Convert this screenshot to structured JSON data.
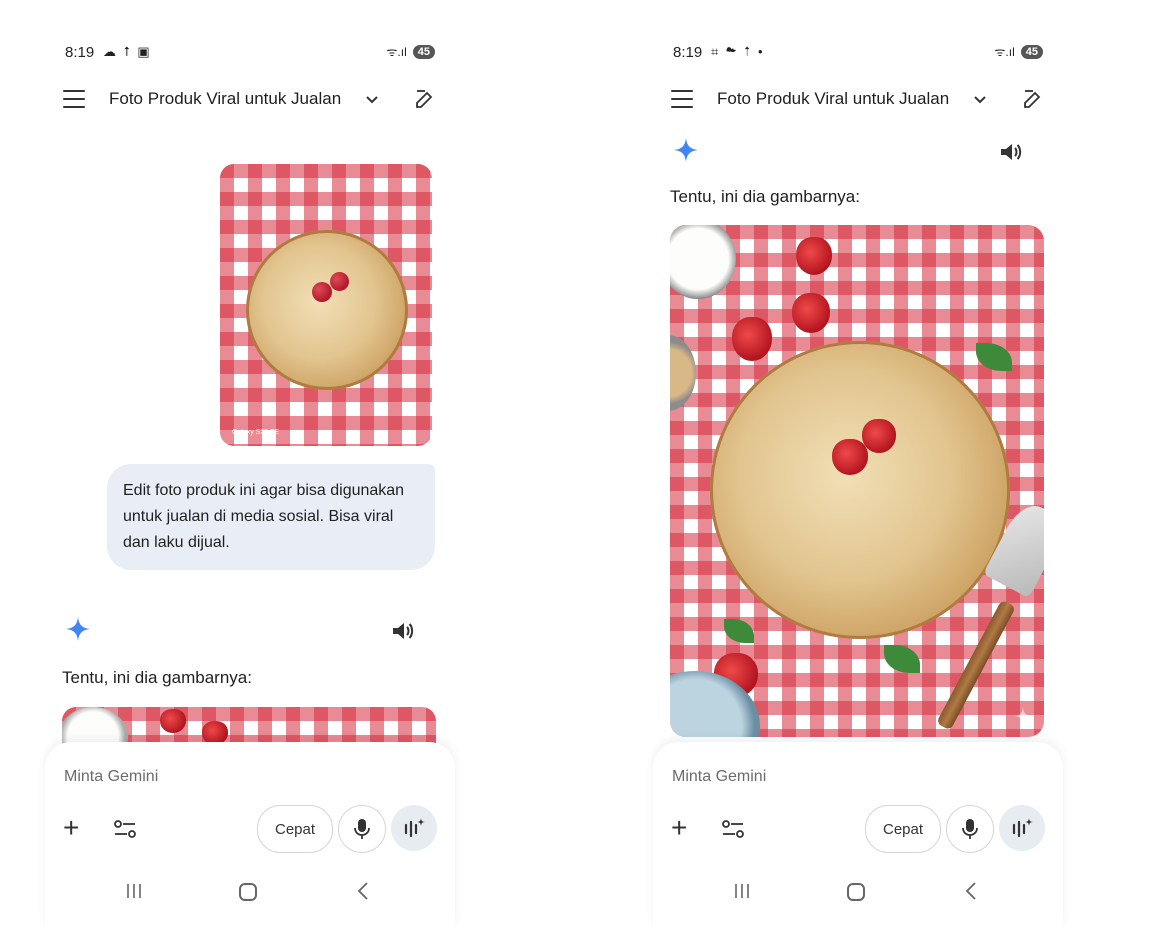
{
  "left": {
    "status": {
      "time": "8:19",
      "icons": "☁ ⭡ ▣",
      "battery": "45",
      "signal": "ᯤ.ıl"
    },
    "appbar": {
      "title": "Foto Produk Viral untuk Jualan",
      "chevron": "⌄"
    },
    "user_image": {
      "watermark": "Galaxy S25 FE"
    },
    "user_message": "Edit foto produk ini agar bisa digunakan untuk jualan di media sosial. Bisa viral dan laku dijual.",
    "response": {
      "text": "Tentu, ini dia gambarnya:"
    },
    "input": {
      "placeholder": "Minta Gemini",
      "mode_label": "Cepat",
      "plus": "+"
    }
  },
  "right": {
    "status": {
      "time": "8:19",
      "icons": "⌗ ☁ ⭡ •",
      "battery": "45",
      "signal": "ᯤ.ıl"
    },
    "appbar": {
      "title": "Foto Produk Viral untuk Jualan",
      "chevron": "⌄"
    },
    "response": {
      "text": "Tentu, ini dia gambarnya:"
    },
    "input": {
      "placeholder": "Minta Gemini",
      "mode_label": "Cepat",
      "plus": "+"
    }
  },
  "colors": {
    "accent": "#4285f4",
    "bubble": "#e9eef6",
    "gingham_red": "#d62c3e"
  },
  "icons": [
    "menu-icon",
    "chevron-down-icon",
    "edit-icon",
    "gemini-sparkle-icon",
    "speaker-icon",
    "plus-icon",
    "tools-icon",
    "mic-icon",
    "gemini-live-icon",
    "nav-recents-icon",
    "nav-home-icon",
    "nav-back-icon"
  ]
}
